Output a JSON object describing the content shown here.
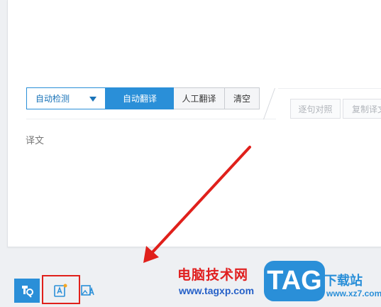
{
  "toolbar": {
    "lang_label": "自动检测",
    "auto_translate": "自动翻译",
    "human_translate": "人工翻译",
    "clear": "清空"
  },
  "right_tools": {
    "compare": "逐句对照",
    "copy": "复制译文"
  },
  "result": {
    "placeholder": "译文"
  },
  "bottom_bar": {
    "icons": [
      "translate-icon",
      "document-translate-icon",
      "image-translate-icon"
    ]
  },
  "watermark": {
    "site_name": "电脑技术网",
    "site_url": "www.tagxp.com",
    "tag": "TAG",
    "xz_text": "下载站",
    "xz_url": "www.xz7.com"
  },
  "colors": {
    "accent": "#2a8fd8",
    "highlight": "#e0201b",
    "panel_bg": "#ffffff",
    "app_bg": "#eef0f3"
  }
}
